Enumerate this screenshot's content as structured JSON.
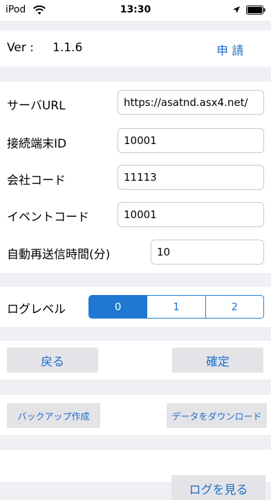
{
  "status_bar": {
    "carrier": "iPod",
    "time": "13:30"
  },
  "version": {
    "label": "Ver :",
    "value": "1.1.6",
    "apply_label": "申 請"
  },
  "settings": {
    "server_url_label": "サーバURL",
    "server_url_value": "https://asatnd.asx4.net/",
    "terminal_id_label": "接続端末ID",
    "terminal_id_value": "10001",
    "company_code_label": "会社コード",
    "company_code_value": "11113",
    "event_code_label": "イベントコード",
    "event_code_value": "10001",
    "resend_label": "自動再送信時間(分)",
    "resend_value": "10"
  },
  "log_level": {
    "label": "ログレベル",
    "options": [
      "0",
      "1",
      "2"
    ],
    "selected": "0"
  },
  "actions": {
    "back": "戻る",
    "confirm": "確定",
    "backup": "バックアップ作成",
    "download": "データをダウンロード",
    "view_log": "ログを見る"
  },
  "colors": {
    "accent": "#1f78d1",
    "background": "#efeff4"
  }
}
